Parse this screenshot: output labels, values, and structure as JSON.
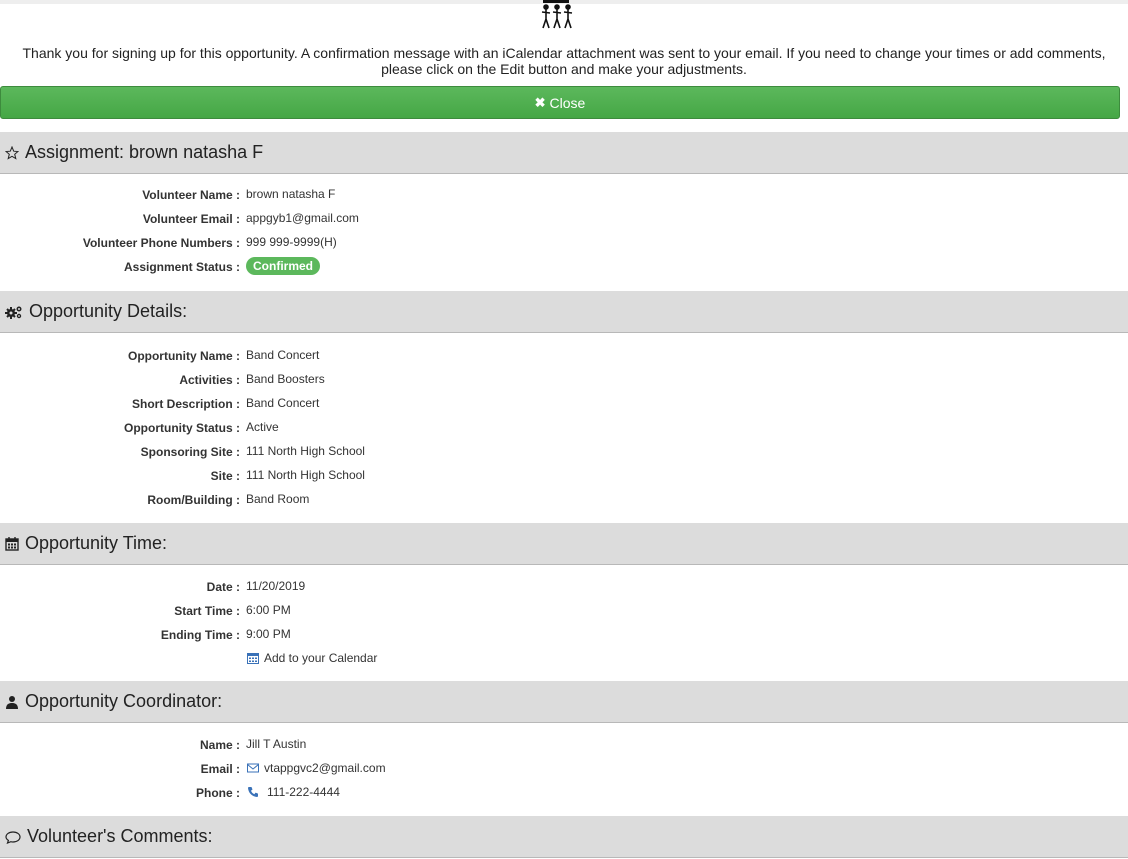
{
  "banner": {
    "message_line1": "Thank you for signing up for this opportunity. A confirmation message with an iCalendar attachment was sent to your email. If you need to change your times or add comments,",
    "message_line2": "please click on the Edit button and make your adjustments.",
    "close_label": "Close"
  },
  "assignment": {
    "heading": "Assignment: brown natasha F",
    "rows": [
      {
        "label": "Volunteer Name :",
        "value": "brown natasha F"
      },
      {
        "label": "Volunteer Email :",
        "value": "appgyb1@gmail.com"
      },
      {
        "label": "Volunteer Phone Numbers :",
        "value": "999 999-9999(H)"
      },
      {
        "label": "Assignment Status :",
        "value": "Confirmed"
      }
    ]
  },
  "details": {
    "heading": "Opportunity Details:",
    "rows": [
      {
        "label": "Opportunity Name :",
        "value": "Band Concert"
      },
      {
        "label": "Activities :",
        "value": "Band Boosters"
      },
      {
        "label": "Short Description :",
        "value": "Band Concert"
      },
      {
        "label": "Opportunity Status :",
        "value": "Active"
      },
      {
        "label": "Sponsoring Site :",
        "value": "111 North High School"
      },
      {
        "label": "Site :",
        "value": "111 North High School"
      },
      {
        "label": "Room/Building :",
        "value": "Band Room"
      }
    ]
  },
  "time": {
    "heading": "Opportunity Time:",
    "rows": [
      {
        "label": "Date :",
        "value": "11/20/2019"
      },
      {
        "label": "Start Time :",
        "value": "6:00 PM"
      },
      {
        "label": "Ending Time :",
        "value": "9:00 PM"
      }
    ],
    "calendar_link": "Add to your Calendar"
  },
  "coordinator": {
    "heading": "Opportunity Coordinator:",
    "rows": [
      {
        "label": "Name :",
        "value": "Jill T Austin"
      },
      {
        "label": "Email :",
        "value": "vtappgvc2@gmail.com"
      },
      {
        "label": "Phone :",
        "value": "111-222-4444"
      }
    ]
  },
  "comments": {
    "heading": "Volunteer's Comments:"
  },
  "colors": {
    "success": "#5cb85c",
    "link": "#3a72b8",
    "section_bg": "#dcdcdc"
  },
  "icons": {
    "close": "close-icon",
    "assignment": "star-icon",
    "details": "gears-icon",
    "time": "calendar-icon",
    "coordinator": "user-icon",
    "comments": "comment-icon",
    "email": "envelope-icon",
    "phone": "phone-icon"
  }
}
